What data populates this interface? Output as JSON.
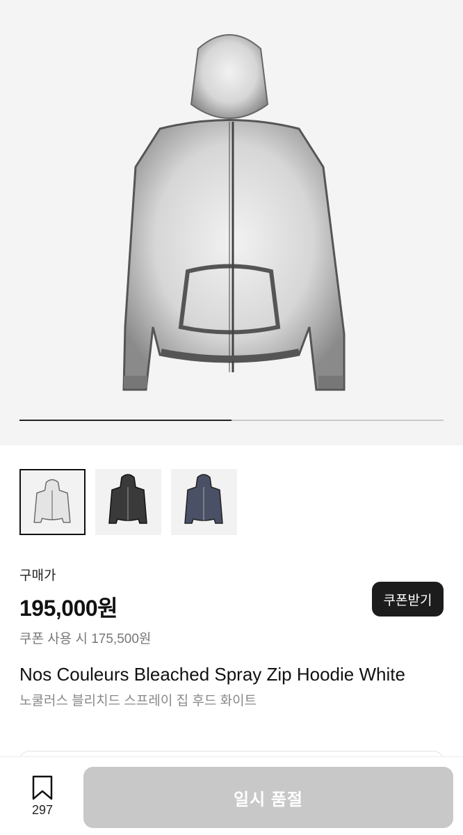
{
  "gallery": {
    "product_image": "hoodie-white-bleached-spray",
    "progress": 0.5
  },
  "thumbnails": [
    {
      "name": "white",
      "selected": true
    },
    {
      "name": "black",
      "selected": false
    },
    {
      "name": "navy",
      "selected": false
    }
  ],
  "pricing": {
    "label": "구매가",
    "price": "195,000원",
    "coupon_price": "쿠폰 사용 시 175,500원",
    "coupon_button": "쿠폰받기"
  },
  "product": {
    "title_en": "Nos Couleurs Bleached Spray Zip Hoodie White",
    "title_ko": "노쿨러스 블리치드 스프레이 집 후드 화이트"
  },
  "bottom_bar": {
    "wish_icon": "bookmark-icon",
    "wish_count": "297",
    "buy_button": "일시 품절"
  },
  "colors": {
    "accent": "#1c1c1c",
    "soldout": "#c8c8c8"
  }
}
